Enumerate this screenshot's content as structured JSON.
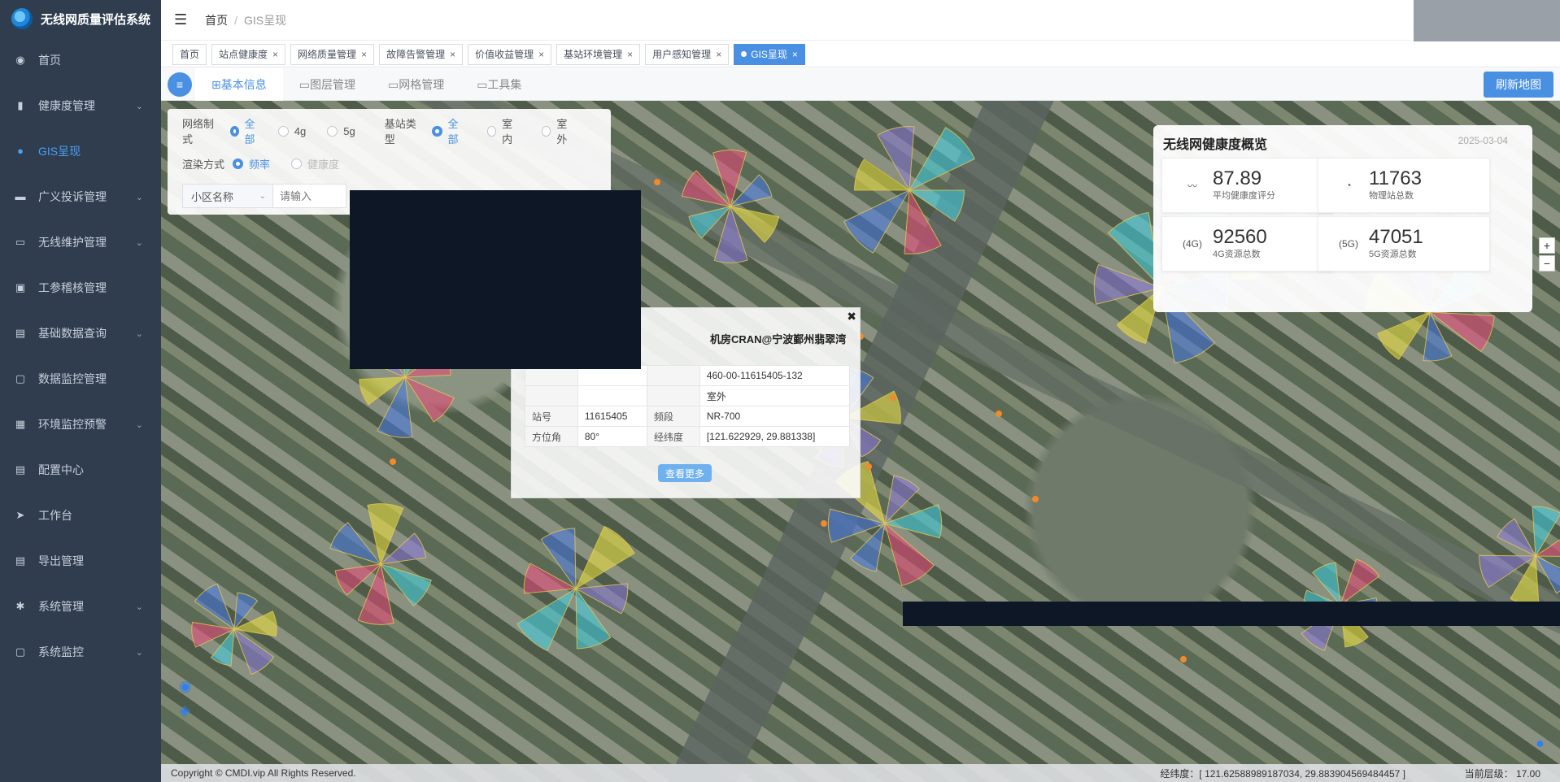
{
  "app": {
    "title": "无线网质量评估系统"
  },
  "sidebar": {
    "items": [
      {
        "label": "首页",
        "icon": "dashboard-icon",
        "glyph": "◉",
        "chev": ""
      },
      {
        "label": "健康度管理",
        "icon": "bar-chart-icon",
        "glyph": "▮",
        "chev": "⌄"
      },
      {
        "label": "GIS呈现",
        "icon": "globe-icon",
        "glyph": "●",
        "chev": ""
      },
      {
        "label": "广义投诉管理",
        "icon": "comment-icon",
        "glyph": "▬",
        "chev": "⌄"
      },
      {
        "label": "无线维护管理",
        "icon": "toolbox-icon",
        "glyph": "▭",
        "chev": "⌄"
      },
      {
        "label": "工参稽核管理",
        "icon": "image-icon",
        "glyph": "▣",
        "chev": ""
      },
      {
        "label": "基础数据查询",
        "icon": "document-icon",
        "glyph": "▤",
        "chev": "⌄"
      },
      {
        "label": "数据监控管理",
        "icon": "monitor-icon",
        "glyph": "▢",
        "chev": ""
      },
      {
        "label": "环境监控预警",
        "icon": "grid-icon",
        "glyph": "▦",
        "chev": "⌄"
      },
      {
        "label": "配置中心",
        "icon": "file-icon",
        "glyph": "▤",
        "chev": ""
      },
      {
        "label": "工作台",
        "icon": "send-icon",
        "glyph": "➤",
        "chev": ""
      },
      {
        "label": "导出管理",
        "icon": "export-icon",
        "glyph": "▤",
        "chev": ""
      },
      {
        "label": "系统管理",
        "icon": "gear-icon",
        "glyph": "✱",
        "chev": "⌄"
      },
      {
        "label": "系统监控",
        "icon": "monitor-chart-icon",
        "glyph": "▢",
        "chev": "⌄"
      }
    ]
  },
  "header": {
    "breadcrumb_home": "首页",
    "breadcrumb_sep": "/",
    "breadcrumb_current": "GIS呈现",
    "menu_glyph": "☰"
  },
  "tabs": [
    {
      "label": "首页",
      "closable": false
    },
    {
      "label": "站点健康度",
      "closable": true
    },
    {
      "label": "网络质量管理",
      "closable": true
    },
    {
      "label": "故障告警管理",
      "closable": true
    },
    {
      "label": "价值收益管理",
      "closable": true
    },
    {
      "label": "基站环境管理",
      "closable": true
    },
    {
      "label": "用户感知管理",
      "closable": true
    },
    {
      "label": "GIS呈现",
      "closable": true,
      "active": true
    }
  ],
  "toolbar": {
    "menu_glyph": "≡",
    "tabs": [
      "⊞基本信息",
      "▭图层管理",
      "▭网格管理",
      "▭工具集"
    ],
    "refresh_label": "刷新地图"
  },
  "filters": {
    "network_label": "网络制式",
    "network_options": [
      "全部",
      "4g",
      "5g"
    ],
    "station_label": "基站类型",
    "station_options": [
      "全部",
      "室内",
      "室外"
    ],
    "render_label": "渲染方式",
    "render_options": [
      "频率",
      "健康度"
    ],
    "cell_select": "小区名称",
    "cell_placeholder": "请输入"
  },
  "popup": {
    "close_glyph": "✖",
    "title": "机房CRAN@宁波鄞州翡翠湾",
    "rows": [
      [
        "",
        "",
        "",
        "460-00-11615405-132"
      ],
      [
        "",
        "",
        "",
        "室外"
      ],
      [
        "站号",
        "11615405",
        "频段",
        "NR-700"
      ],
      [
        "方位角",
        "80°",
        "经纬度",
        "[121.622929, 29.881338]"
      ]
    ],
    "more_label": "查看更多"
  },
  "overview": {
    "title": "无线网健康度概览",
    "date": "2025-03-04",
    "cards": [
      {
        "value": "87.89",
        "label": "平均健康度评分",
        "icon": "health-pulse-icon",
        "glyph": "〰"
      },
      {
        "value": "11763",
        "label": "物理站总数",
        "icon": "pie-icon",
        "glyph": "◔"
      },
      {
        "value": "92560",
        "label": "4G资源总数",
        "icon": "antenna-4g-icon",
        "glyph": "(4G)"
      },
      {
        "value": "47051",
        "label": "5G资源总数",
        "icon": "antenna-5g-icon",
        "glyph": "(5G)"
      }
    ]
  },
  "zoom": {
    "in": "+",
    "out": "−"
  },
  "footer": {
    "copyright": "Copyright © CMDI.vip All Rights Reserved.",
    "coords": "经纬度：[ 121.62588989187034, 29.883904569484457 ]",
    "level": "当前层级：  17.00"
  },
  "colors": {
    "accent": "#4a90e2",
    "sidebar_bg": "#2f3d4f",
    "redact": "#0e1726"
  }
}
